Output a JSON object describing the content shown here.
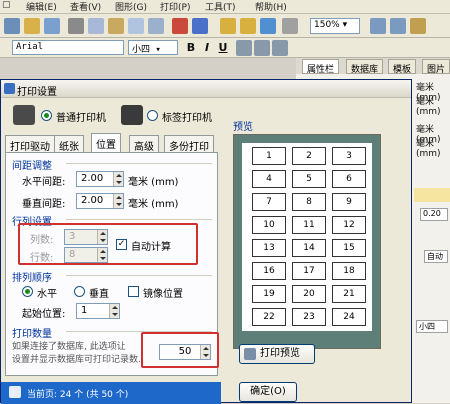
{
  "menu": [
    "编辑(E)",
    "查看(V)",
    "图形(G)",
    "打印(P)",
    "工具(T)",
    "帮助(H)"
  ],
  "zoom": "150%",
  "font": {
    "name": "Arial",
    "size": "小四"
  },
  "format_buttons": [
    "B",
    "I",
    "U"
  ],
  "right_panel": {
    "tabs": [
      "属性栏",
      "数据库",
      "模板",
      "图片"
    ],
    "lines": [
      "毫米 (mm)",
      "毫米 (mm)",
      "毫米 (mm)",
      "毫米 (mm)"
    ],
    "values": [
      "0.20",
      "自动",
      "小四"
    ]
  },
  "dialog": {
    "title": "打印设置",
    "printer_normal": "普通打印机",
    "printer_label": "标签打印机",
    "tabs": [
      "打印驱动",
      "纸张",
      "位置",
      "高级",
      "多份打印"
    ],
    "group_spacing": "间距调整",
    "h_spacing_label": "水平间距:",
    "h_spacing_value": "2.00",
    "h_unit": "毫米 (mm)",
    "v_spacing_label": "垂直间距:",
    "v_spacing_value": "2.00",
    "v_unit": "毫米 (mm)",
    "group_rowcol": "行列设置",
    "cols_label": "列数:",
    "cols_value": "3",
    "rows_label": "行数:",
    "rows_value": "8",
    "auto_calc": "自动计算",
    "group_order": "排列顺序",
    "order_h": "水平",
    "order_v": "垂直",
    "mirror": "镜像位置",
    "start_label": "起始位置:",
    "start_value": "1",
    "preview_label": "预览",
    "preview_cells": [
      "1",
      "2",
      "3",
      "4",
      "5",
      "6",
      "7",
      "8",
      "9",
      "10",
      "11",
      "12",
      "13",
      "14",
      "15",
      "16",
      "17",
      "18",
      "19",
      "20",
      "21",
      "22",
      "23",
      "24"
    ],
    "group_quantity": "打印数量",
    "quantity_hint": "如果连接了数据库, 此选项让\n设置并显示数据库可打印记录数.",
    "quantity_value": "50",
    "print_preview": "打印预览",
    "ok": "确定(O)",
    "status": "当前页: 24 个 (共 50 个)"
  }
}
